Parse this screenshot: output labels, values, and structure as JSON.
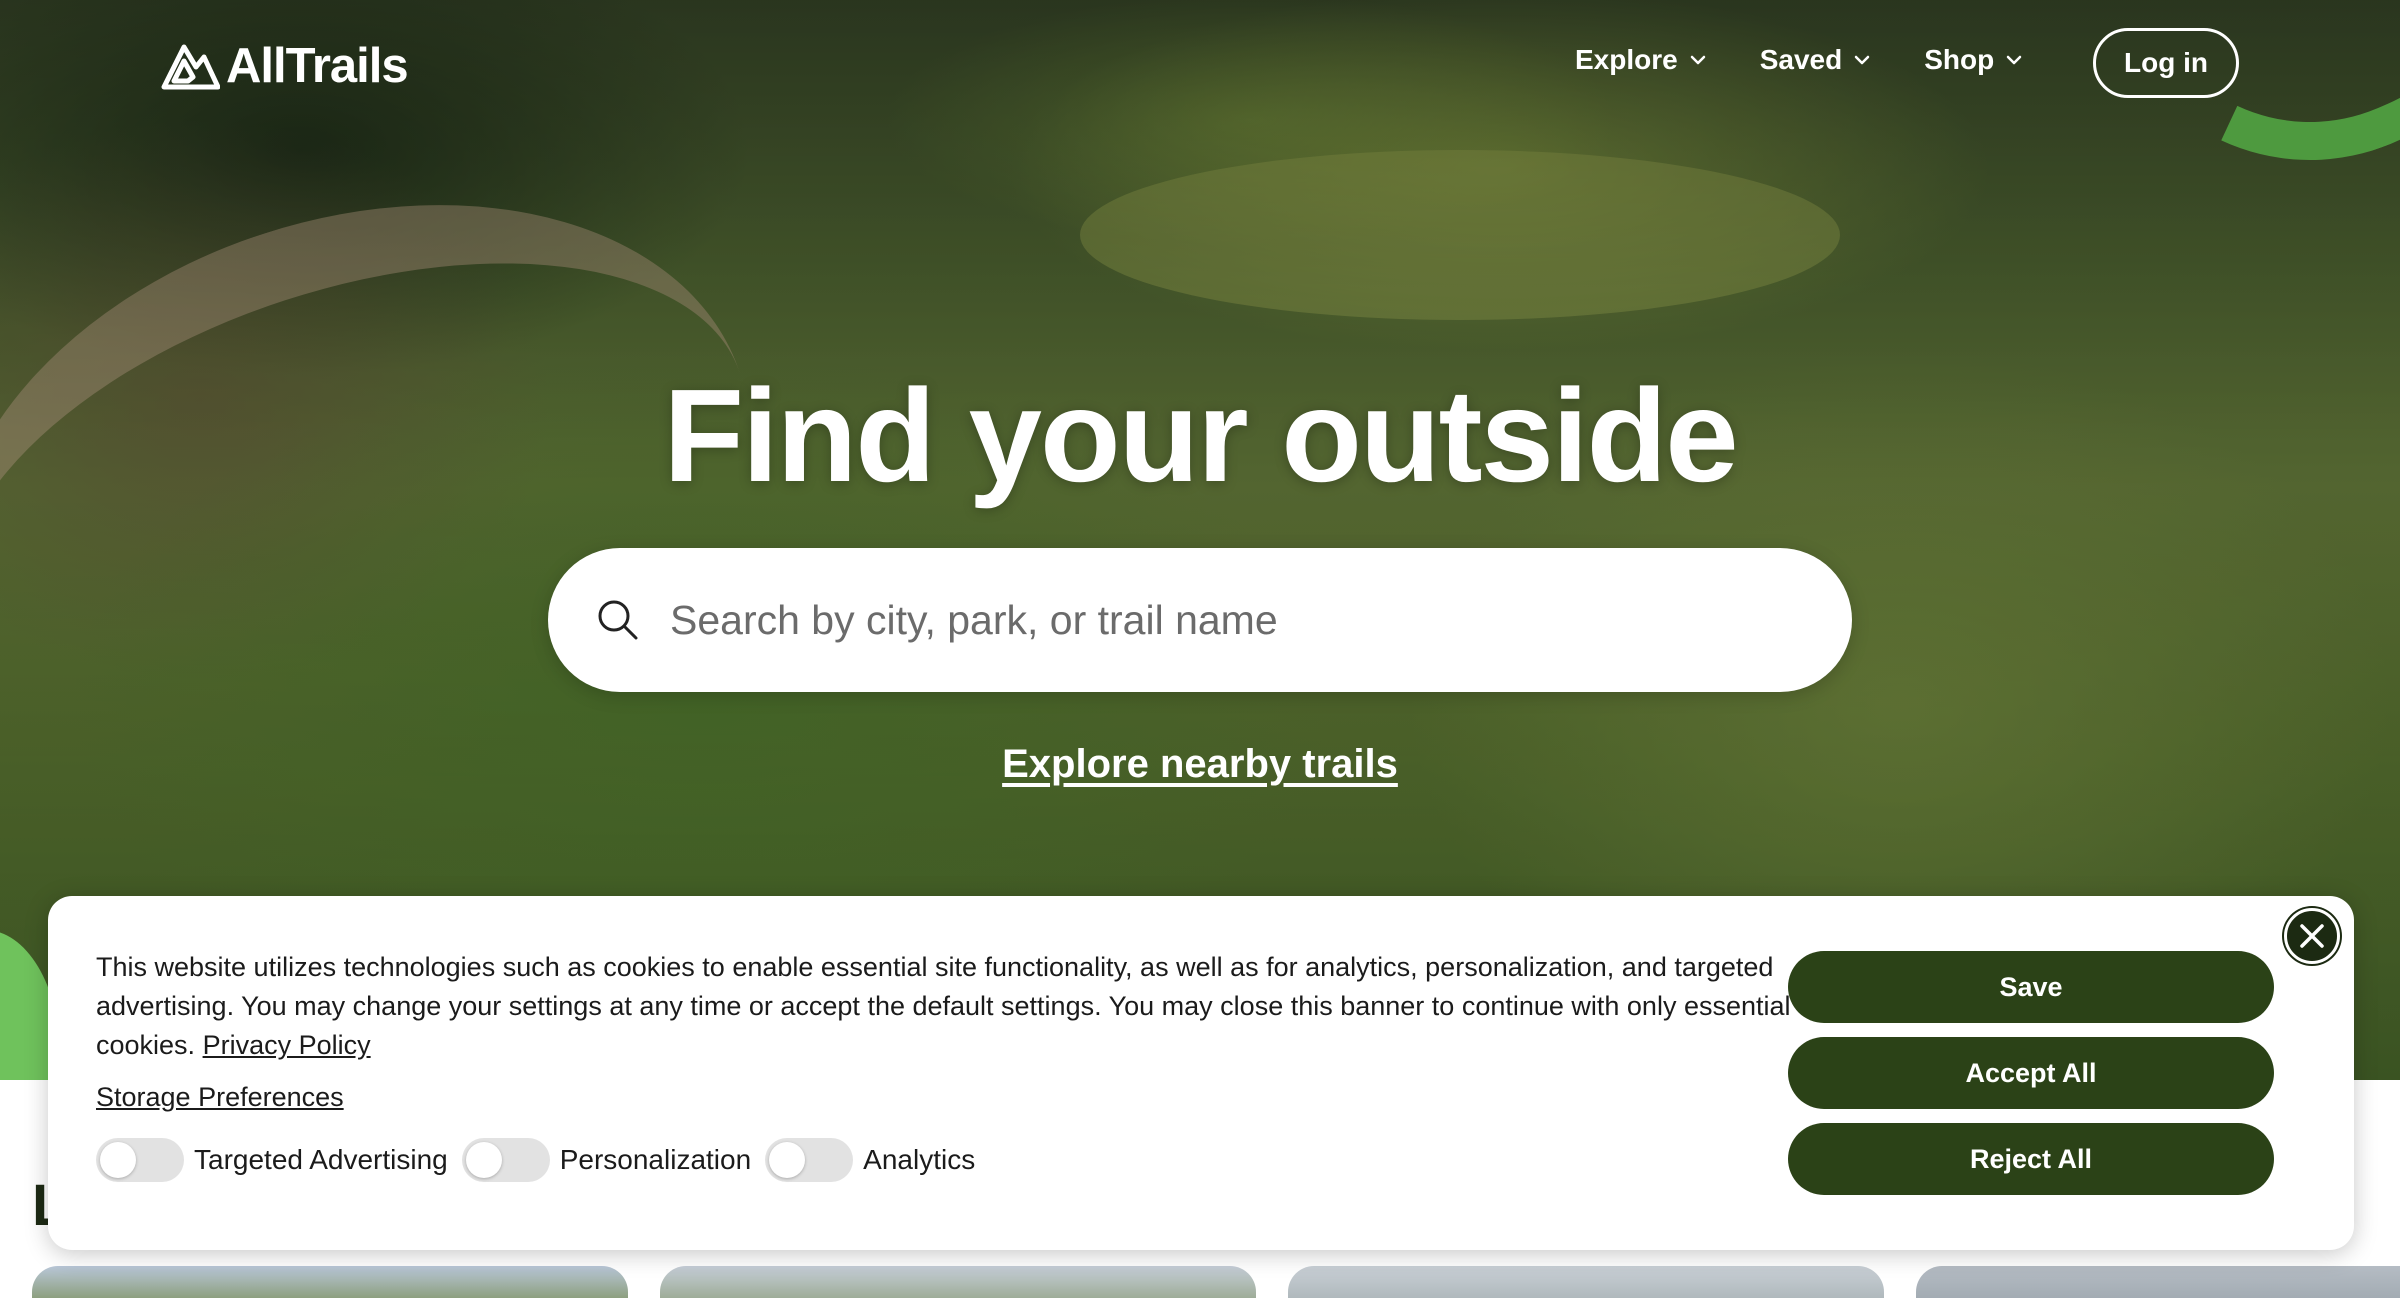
{
  "brand": {
    "name": "AllTrails",
    "logo_icon": "mountain-logo-icon",
    "accent": "#2b4217",
    "accent_bright": "#6fc25c"
  },
  "nav": {
    "items": [
      {
        "label": "Explore",
        "icon": "chevron-down-icon"
      },
      {
        "label": "Saved",
        "icon": "chevron-down-icon"
      },
      {
        "label": "Shop",
        "icon": "chevron-down-icon"
      }
    ],
    "login_label": "Log in"
  },
  "hero": {
    "headline": "Find your outside",
    "search_placeholder": "Search by city, park, or trail name",
    "search_icon": "search-icon",
    "nearby_link": "Explore nearby trails"
  },
  "section": {
    "partial_title": "L"
  },
  "cookie_banner": {
    "message": "This website utilizes technologies such as cookies to enable essential site functionality, as well as for analytics, personalization, and targeted advertising. You may change your settings at any time or accept the default settings. You may close this banner to continue with only essential cookies.",
    "privacy_link": "Privacy Policy",
    "storage_link": "Storage Preferences",
    "toggles": [
      {
        "label": "Targeted Advertising",
        "enabled": false
      },
      {
        "label": "Personalization",
        "enabled": false
      },
      {
        "label": "Analytics",
        "enabled": false
      }
    ],
    "buttons": {
      "save": "Save",
      "accept": "Accept All",
      "reject": "Reject All"
    },
    "close_icon": "close-icon"
  }
}
